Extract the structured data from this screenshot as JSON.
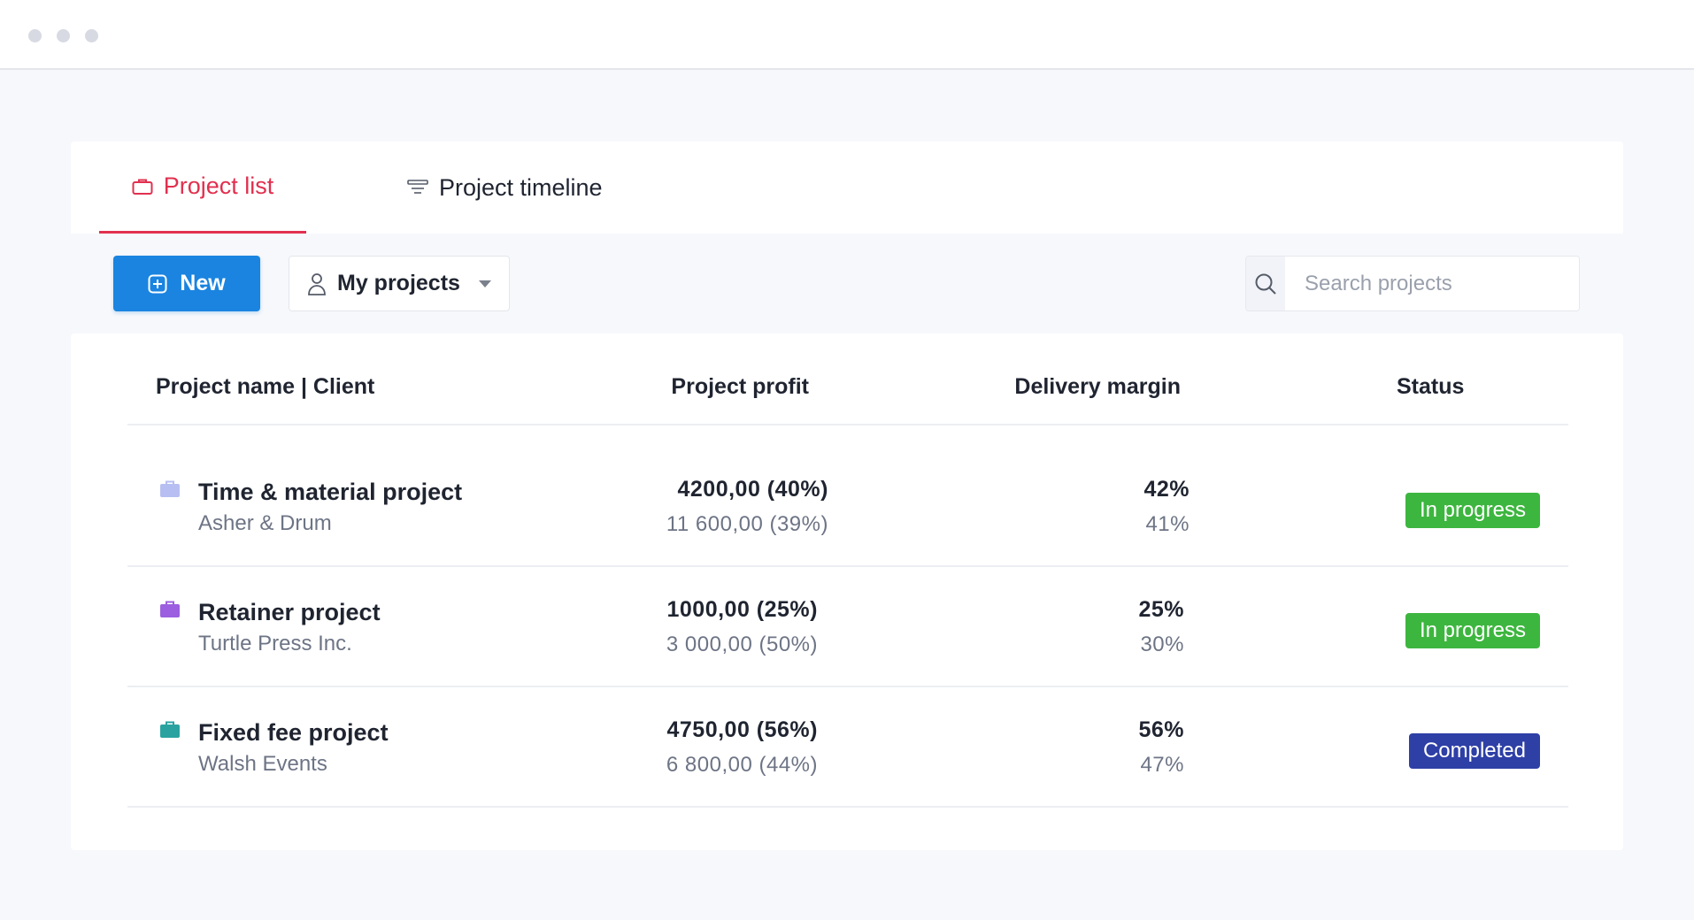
{
  "tabs": [
    {
      "label": "Project list",
      "icon": "briefcase-icon",
      "active": true
    },
    {
      "label": "Project timeline",
      "icon": "timeline-icon",
      "active": false
    }
  ],
  "toolbar": {
    "new_label": "New",
    "filter_label": "My projects",
    "search_placeholder": "Search projects"
  },
  "table": {
    "headers": {
      "name": "Project name | Client",
      "profit": "Project profit",
      "margin": "Delivery margin",
      "status": "Status"
    },
    "rows": [
      {
        "name": "Time & material project",
        "client": "Asher & Drum",
        "profit_main": "4200,00 (40%)",
        "profit_sub": "11 600,00 (39%)",
        "margin_main": "42%",
        "margin_sub": "41%",
        "status": "In progress",
        "color": "#b7bff2"
      },
      {
        "name": "Retainer project",
        "client": "Turtle Press Inc.",
        "profit_main": "1000,00 (25%)",
        "profit_sub": "3 000,00 (50%)",
        "margin_main": "25%",
        "margin_sub": "30%",
        "status": "In progress",
        "color": "#9b5fe0"
      },
      {
        "name": "Fixed fee project",
        "client": "Walsh Events",
        "profit_main": "4750,00 (56%)",
        "profit_sub": "6 800,00 (44%)",
        "margin_main": "56%",
        "margin_sub": "47%",
        "status": "Completed",
        "color": "#2aa3a0"
      }
    ]
  },
  "colors": {
    "accent": "#e1304f",
    "primary": "#1a84e0",
    "in_progress": "#3db63f",
    "completed": "#2e3fa6"
  }
}
